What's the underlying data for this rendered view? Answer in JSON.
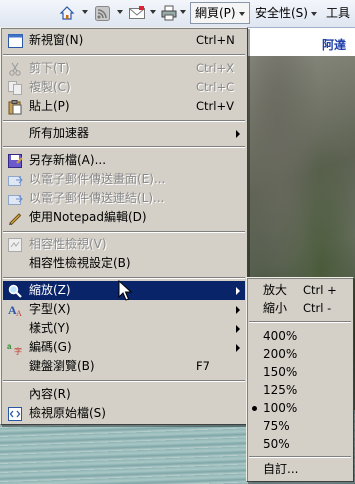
{
  "toolbar": {
    "menus": [
      {
        "label": "網頁(P)"
      },
      {
        "label": "安全性(S)"
      },
      {
        "label": "工具"
      }
    ]
  },
  "background": {
    "link_text": "阿達"
  },
  "main_menu": {
    "items": [
      {
        "label": "新視窗(N)",
        "shortcut": "Ctrl+N",
        "icon": "new-window-icon",
        "disabled": false
      },
      {
        "label": "剪下(T)",
        "shortcut": "Ctrl+X",
        "icon": "scissors-icon",
        "disabled": true
      },
      {
        "label": "複製(C)",
        "shortcut": "Ctrl+C",
        "icon": "copy-icon",
        "disabled": true
      },
      {
        "label": "貼上(P)",
        "shortcut": "Ctrl+V",
        "icon": "paste-icon",
        "disabled": false
      },
      {
        "label": "所有加速器",
        "shortcut": "",
        "icon": "",
        "disabled": false,
        "submenu": true
      },
      {
        "label": "另存新檔(A)...",
        "shortcut": "",
        "icon": "save-icon",
        "disabled": false
      },
      {
        "label": "以電子郵件傳送畫面(E)...",
        "shortcut": "",
        "icon": "email-page-icon",
        "disabled": true
      },
      {
        "label": "以電子郵件傳送連結(L)...",
        "shortcut": "",
        "icon": "email-link-icon",
        "disabled": true
      },
      {
        "label": "使用Notepad編輯(D)",
        "shortcut": "",
        "icon": "pencil-icon",
        "disabled": false
      },
      {
        "label": "相容性檢視(V)",
        "shortcut": "",
        "icon": "compat-view-icon",
        "disabled": true
      },
      {
        "label": "相容性檢視設定(B)",
        "shortcut": "",
        "icon": "",
        "disabled": false
      },
      {
        "label": "縮放(Z)",
        "shortcut": "",
        "icon": "zoom-icon",
        "disabled": false,
        "submenu": true,
        "highlighted": true
      },
      {
        "label": "字型(X)",
        "shortcut": "",
        "icon": "font-icon",
        "disabled": false,
        "submenu": true
      },
      {
        "label": "樣式(Y)",
        "shortcut": "",
        "icon": "",
        "disabled": false,
        "submenu": true
      },
      {
        "label": "編碼(G)",
        "shortcut": "",
        "icon": "encoding-icon",
        "disabled": false,
        "submenu": true
      },
      {
        "label": "鍵盤瀏覽(B)",
        "shortcut": "F7",
        "icon": "",
        "disabled": false
      },
      {
        "label": "內容(R)",
        "shortcut": "",
        "icon": "",
        "disabled": false
      },
      {
        "label": "檢視原始檔(S)",
        "shortcut": "",
        "icon": "view-source-icon",
        "disabled": false
      }
    ]
  },
  "zoom_menu": {
    "zoom_in": {
      "label": "放大",
      "shortcut": "Ctrl +"
    },
    "zoom_out": {
      "label": "縮小",
      "shortcut": "Ctrl -"
    },
    "levels": [
      "400%",
      "200%",
      "150%",
      "125%",
      "100%",
      "75%",
      "50%"
    ],
    "selected_level": "100%",
    "custom": "自訂..."
  }
}
